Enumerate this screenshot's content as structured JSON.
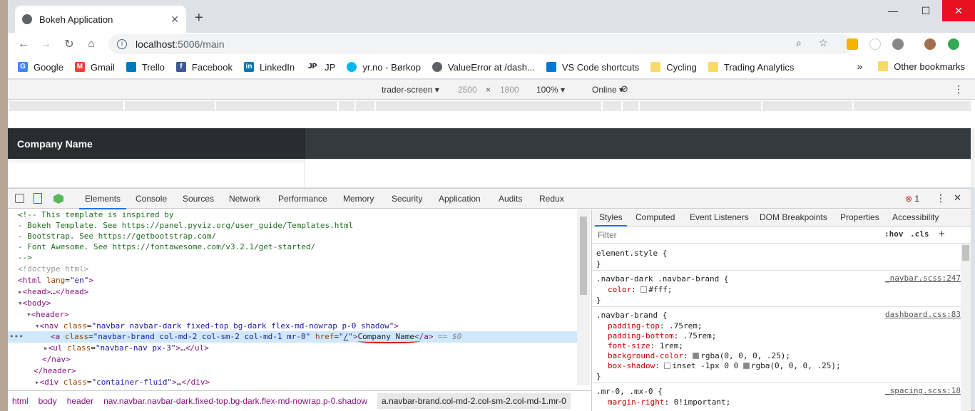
{
  "browser": {
    "tab_title": "Bokeh Application",
    "url_host": "localhost",
    "url_path": ":5006/main",
    "bookmarks": [
      "Google",
      "Gmail",
      "Trello",
      "Facebook",
      "LinkedIn",
      "JP",
      "yr.no - Børkop",
      "ValueError at /dash...",
      "VS Code shortcuts",
      "Cycling",
      "Trading Analytics"
    ],
    "other_bookmarks": "Other bookmarks",
    "more_bookmarks": "»"
  },
  "device_toolbar": {
    "device": "trader-screen",
    "width": "2500",
    "height": "1800",
    "times": "×",
    "zoom": "100%",
    "network": "Online"
  },
  "page": {
    "brand": "Company Name"
  },
  "devtools": {
    "tabs": [
      "Elements",
      "Console",
      "Sources",
      "Network",
      "Performance",
      "Memory",
      "Security",
      "Application",
      "Audits",
      "Redux"
    ],
    "error_count": "1",
    "breadcrumbs": [
      "html",
      "body",
      "header",
      "nav.navbar.navbar-dark.fixed-top.bg-dark.flex-md-nowrap.p-0.shadow",
      "a.navbar-brand.col-md-2.col-sm-2.col-md-1.mr-0"
    ],
    "styles_tabs": [
      "Styles",
      "Computed",
      "Event Listeners",
      "DOM Breakpoints",
      "Properties",
      "Accessibility"
    ],
    "filter_placeholder": "Filter",
    "hov": ":hov",
    "cls": ".cls",
    "dom_comment": [
      "<!-- This template is inspired by",
      "- Bokeh Template. See https://panel.pyviz.org/user_guide/Templates.html",
      "- Bootstrap. See https://getbootstrap.com/",
      "- Font Awesome. See https://fontawesome.com/v3.2.1/get-started/",
      "-->"
    ],
    "doctype": "<!doctype html>",
    "selected_text": "Company Name",
    "selected_suffix": " == $0",
    "rules": [
      {
        "selector": "element.style {",
        "source": ""
      },
      {
        "selector": ".navbar-dark .navbar-brand {",
        "source": "_navbar.scss:247"
      },
      {
        "selector": ".navbar-brand {",
        "source": "dashboard.css:83"
      },
      {
        "selector": ".mr-0, .mx-0 {",
        "source": "_spacing.scss:18"
      }
    ]
  }
}
